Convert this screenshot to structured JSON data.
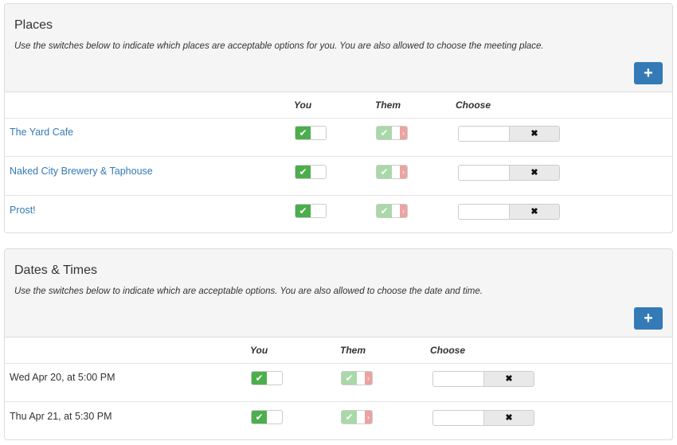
{
  "places": {
    "title": "Places",
    "description": "Use the switches below to indicate which places are acceptable options for you.  You are also allowed to choose the meeting place.",
    "add_label": "+",
    "columns": {
      "you": "You",
      "them": "Them",
      "choose": "Choose"
    },
    "rows": [
      {
        "name": "The Yard Cafe",
        "you": true,
        "them": true,
        "choose": false
      },
      {
        "name": "Naked City Brewery & Taphouse",
        "you": true,
        "them": true,
        "choose": false
      },
      {
        "name": "Prost!",
        "you": true,
        "them": true,
        "choose": false
      }
    ]
  },
  "dates": {
    "title": "Dates & Times",
    "description": "Use the switches below to indicate which are acceptable options.  You are also allowed to choose the date and time.",
    "add_label": "+",
    "columns": {
      "you": "You",
      "them": "Them",
      "choose": "Choose"
    },
    "rows": [
      {
        "name": "Wed Apr 20, at 5:00 PM",
        "you": true,
        "them": true,
        "choose": false
      },
      {
        "name": "Thu Apr 21, at 5:30 PM",
        "you": true,
        "them": true,
        "choose": false
      }
    ]
  },
  "glyphs": {
    "check": "✔",
    "x": "✖",
    "chevron": "›"
  },
  "colors": {
    "primary": "#337ab7",
    "success": "#4cae4c",
    "danger": "#d9534f"
  }
}
